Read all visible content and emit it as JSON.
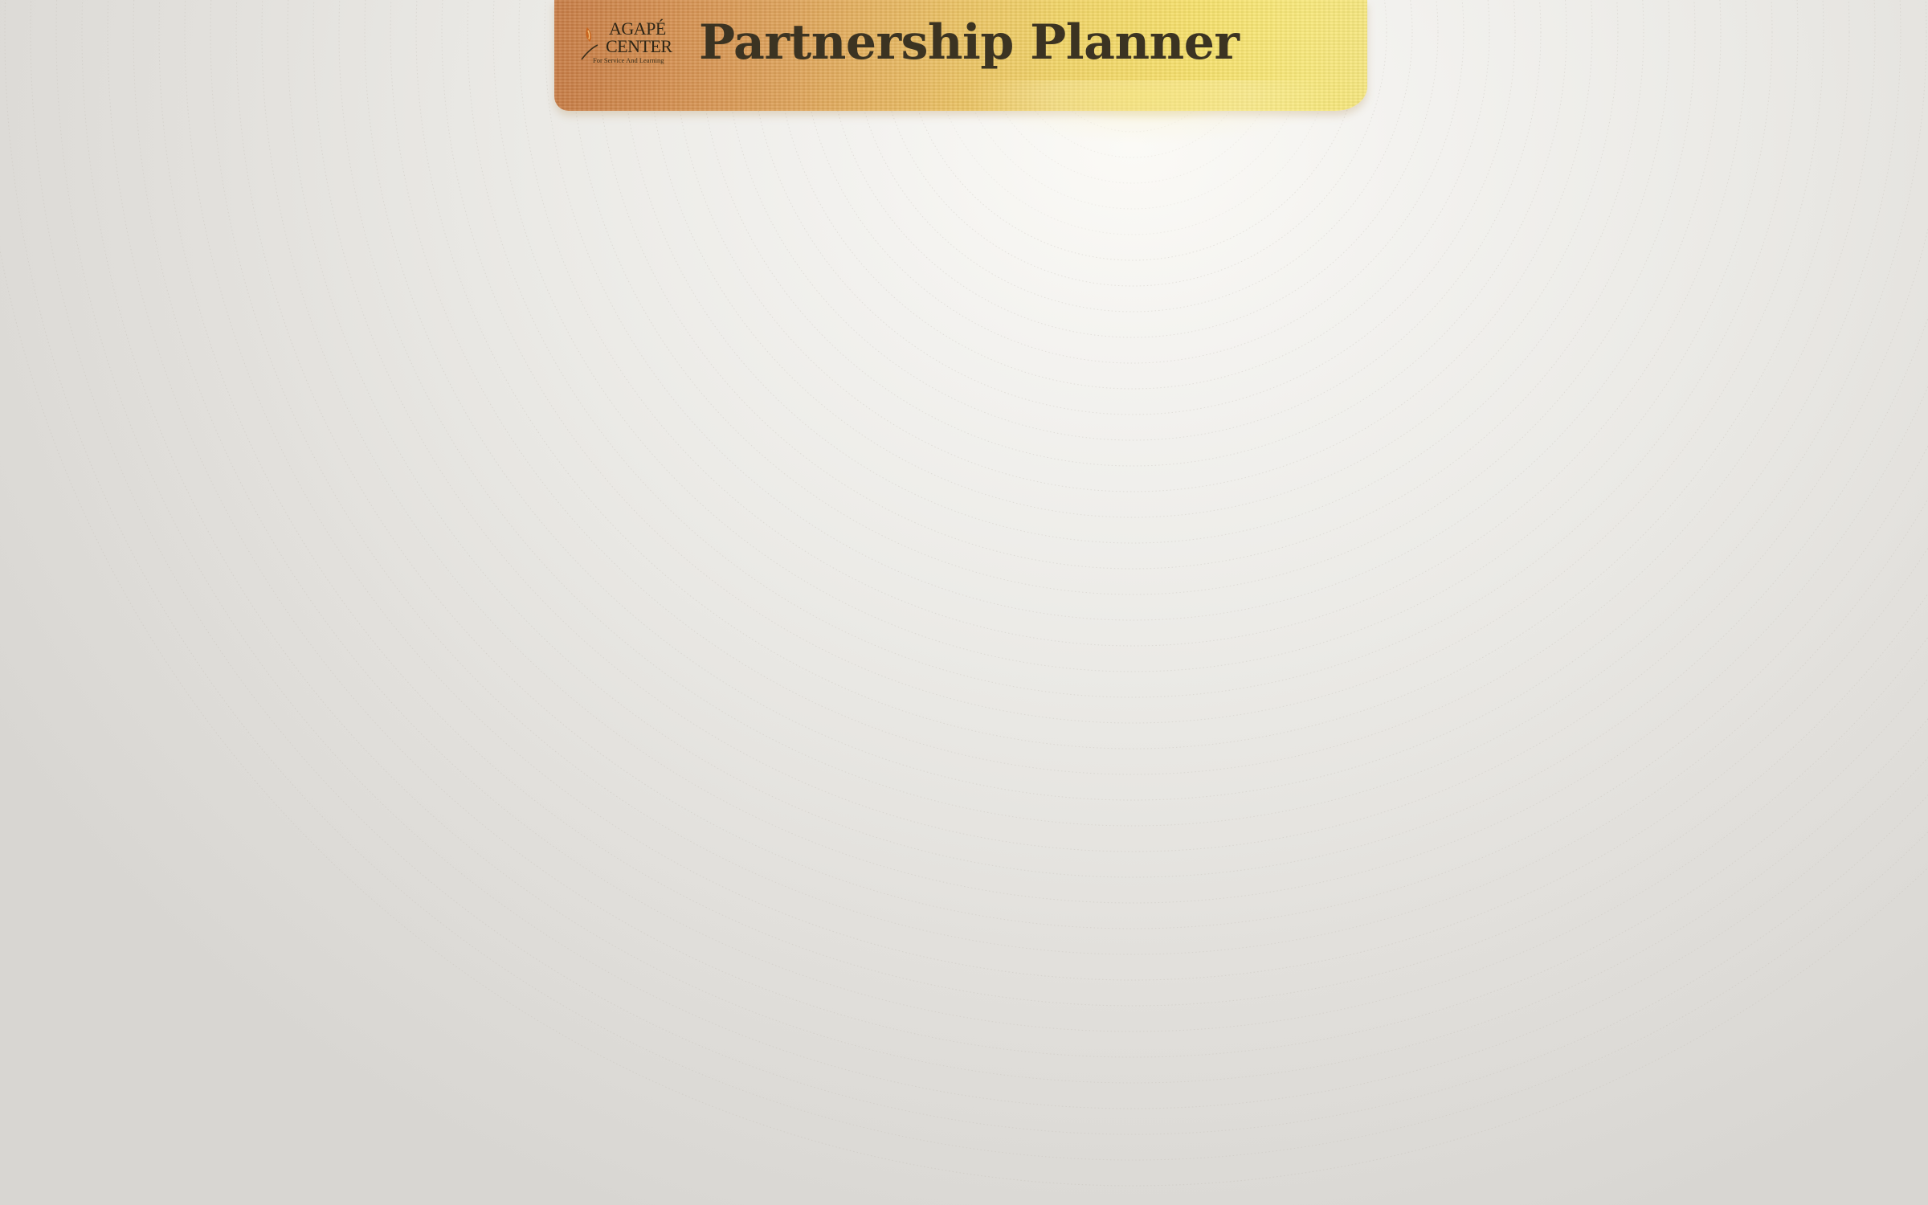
{
  "header": {
    "logo": {
      "line1": "AGAPÉ",
      "line2": "CENTER",
      "tagline": "For Service And Learning"
    },
    "title": "Partnership Planner"
  },
  "colors": {
    "background": "#dcdad6",
    "background_highlight": "#fbfaf6",
    "banner_left": "#c77c45",
    "banner_right": "#f6e67e",
    "title_text": "#3b3322",
    "logo_accent": "#c9651f"
  }
}
